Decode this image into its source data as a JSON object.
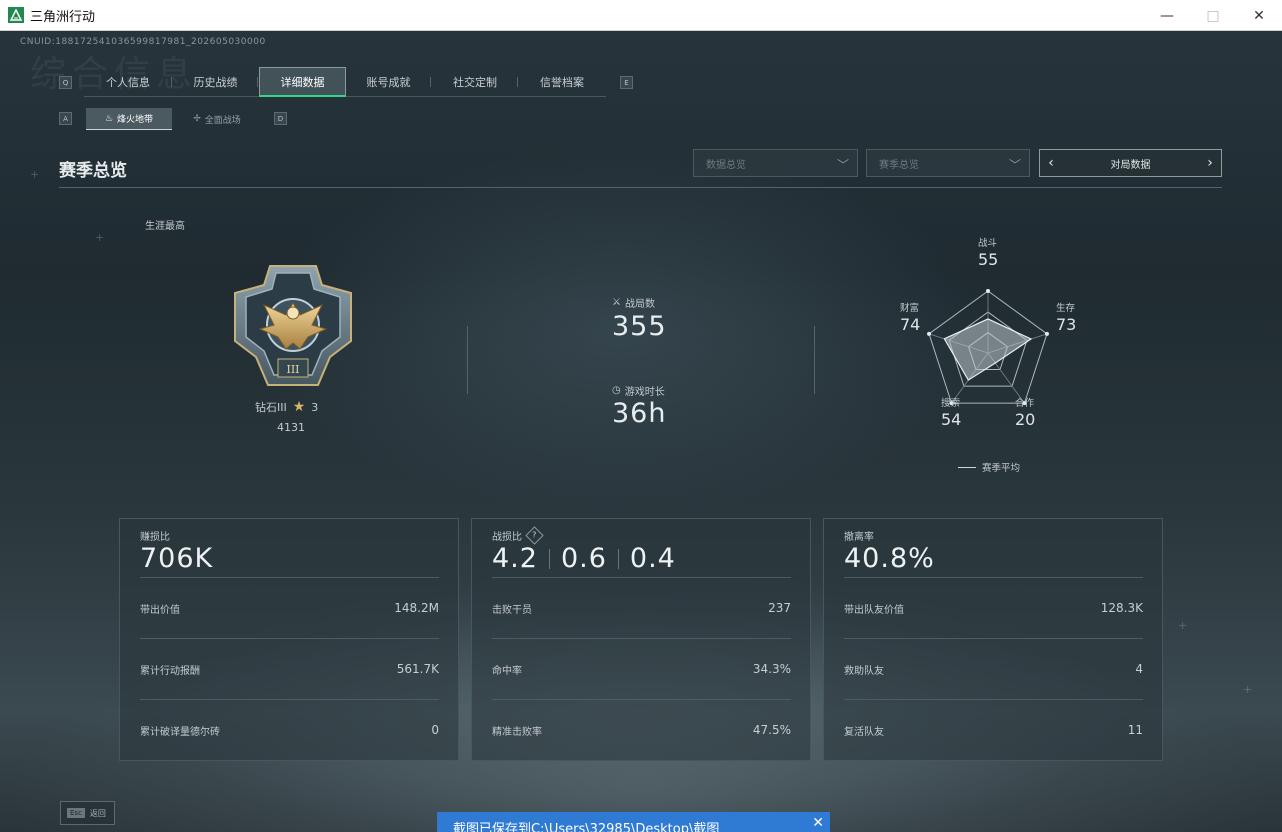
{
  "window": {
    "title": "三角洲行动",
    "controls": [
      "—",
      "□",
      "✕"
    ]
  },
  "header": {
    "cnuid": "CNUID:188172541036599817981_202605030000"
  },
  "nav": {
    "left_key": "Q",
    "right_key": "E",
    "tabs": [
      "个人信息",
      "历史战绩",
      "详细数据",
      "账号成就",
      "社交定制",
      "信誉档案"
    ],
    "active_tab": "详细数据"
  },
  "subnav": {
    "left_key": "A",
    "right_key": "D",
    "tabs": [
      "烽火地带",
      "全面战场"
    ],
    "active_tab": "烽火地带"
  },
  "section": {
    "title": "赛季总览",
    "dropdown_1": "数据总览",
    "dropdown_2": "赛季总览",
    "pager_label": "对局数据"
  },
  "career": {
    "label": "生涯最高",
    "rank_name": "钻石III",
    "rank_stars": "3",
    "rank_score": "4131"
  },
  "summary": {
    "matches_label": "战局数",
    "matches_value": "355",
    "playtime_label": "游戏时长",
    "playtime_value": "36h"
  },
  "radar": {
    "axes": [
      {
        "label": "战斗",
        "value": 55
      },
      {
        "label": "生存",
        "value": 73
      },
      {
        "label": "合作",
        "value": 20
      },
      {
        "label": "搜索",
        "value": 54
      },
      {
        "label": "财富",
        "value": 74
      }
    ],
    "legend": "赛季平均"
  },
  "panels": [
    {
      "title": "赚损比",
      "value_parts": [
        "706K"
      ],
      "rows": [
        {
          "label": "带出价值",
          "value": "148.2M"
        },
        {
          "label": "累计行动报酬",
          "value": "561.7K"
        },
        {
          "label": "累计破译量德尔砖",
          "value": "0"
        }
      ]
    },
    {
      "title": "战损比",
      "value_parts": [
        "4.2",
        "0.6",
        "0.4"
      ],
      "rows": [
        {
          "label": "击败干员",
          "value": "237"
        },
        {
          "label": "命中率",
          "value": "34.3%"
        },
        {
          "label": "精准击败率",
          "value": "47.5%"
        }
      ]
    },
    {
      "title": "撤离率",
      "value_parts": [
        "40.8%"
      ],
      "rows": [
        {
          "label": "带出队友价值",
          "value": "128.3K"
        },
        {
          "label": "救助队友",
          "value": "4"
        },
        {
          "label": "复活队友",
          "value": "11"
        }
      ]
    }
  ],
  "footer": {
    "esc_key": "Esc",
    "esc_label": "返回"
  },
  "toast": {
    "text": "截图已保存到C:\\Users\\32985\\Desktop\\截图"
  },
  "colors": {
    "accent_green": "#34d68a",
    "toast_blue": "#2f7bd4",
    "rank_gold": "#d8b36a"
  }
}
